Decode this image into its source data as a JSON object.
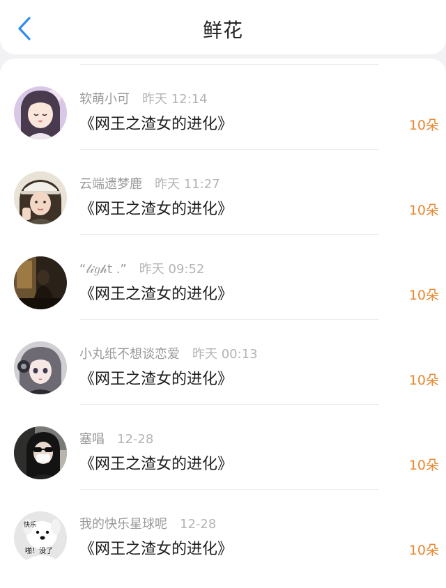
{
  "header": {
    "back_icon": "chevron-left-icon",
    "title": "鲜花",
    "accent_color": "#2f8cf0"
  },
  "items": [
    {
      "name": "软萌小可",
      "time": "昨天 12:14",
      "book": "《网王之渣女的进化》",
      "count": "10朵",
      "avatar": "anime-girl-avatar"
    },
    {
      "name": "云端遗梦鹿",
      "time": "昨天 11:27",
      "book": "《网王之渣女的进化》",
      "count": "10朵",
      "avatar": "selfie-girl-cap-avatar"
    },
    {
      "name": "“𝓁𝒾𝑔𝒽t .”",
      "time": "昨天 09:52",
      "book": "《网王之渣女的进化》",
      "count": "10朵",
      "avatar": "dark-silhouette-avatar"
    },
    {
      "name": "小丸纸不想谈恋爱",
      "time": "昨天 00:13",
      "book": "《网王之渣女的进化》",
      "count": "10朵",
      "avatar": "anime-girl-headphones-avatar"
    },
    {
      "name": "塞唱",
      "time": "12-28",
      "book": "《网王之渣女的进化》",
      "count": "10朵",
      "avatar": "sunglasses-mask-avatar"
    },
    {
      "name": "我的快乐星球呢",
      "time": "12-28",
      "book": "《网王之渣女的进化》",
      "count": "10朵",
      "avatar": "dog-meme-avatar",
      "avatar_text": [
        "快乐",
        "啪！没了"
      ]
    }
  ],
  "count_color": "#e8862e"
}
